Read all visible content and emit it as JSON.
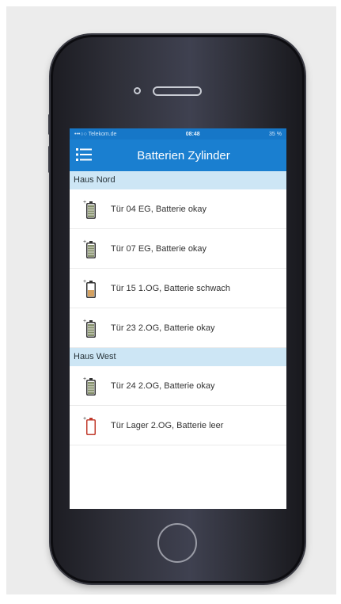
{
  "status_bar": {
    "carrier": "•••○○ Telekom.de",
    "time": "08:48",
    "battery": "35 %"
  },
  "nav": {
    "title": "Batterien Zylinder",
    "menu_icon": "list-icon"
  },
  "sections": [
    {
      "title": "Haus Nord",
      "items": [
        {
          "label": "Tür 04 EG, Batterie okay",
          "status": "okay",
          "icon": "battery-full-icon"
        },
        {
          "label": "Tür 07 EG, Batterie okay",
          "status": "okay",
          "icon": "battery-full-icon"
        },
        {
          "label": "Tür 15 1.OG, Batterie schwach",
          "status": "schwach",
          "icon": "battery-low-icon"
        },
        {
          "label": "Tür 23 2.OG, Batterie okay",
          "status": "okay",
          "icon": "battery-full-icon"
        }
      ]
    },
    {
      "title": "Haus West",
      "items": [
        {
          "label": "Tür 24 2.OG, Batterie okay",
          "status": "okay",
          "icon": "battery-full-icon"
        },
        {
          "label": "Tür Lager 2.OG, Batterie leer",
          "status": "leer",
          "icon": "battery-empty-icon"
        }
      ]
    }
  ],
  "colors": {
    "nav_blue": "#1a7fd0",
    "section_bg": "#cde6f5",
    "battery_okay": "#5c6b3a",
    "battery_low": "#c98a3a",
    "battery_empty": "#c0392b"
  }
}
